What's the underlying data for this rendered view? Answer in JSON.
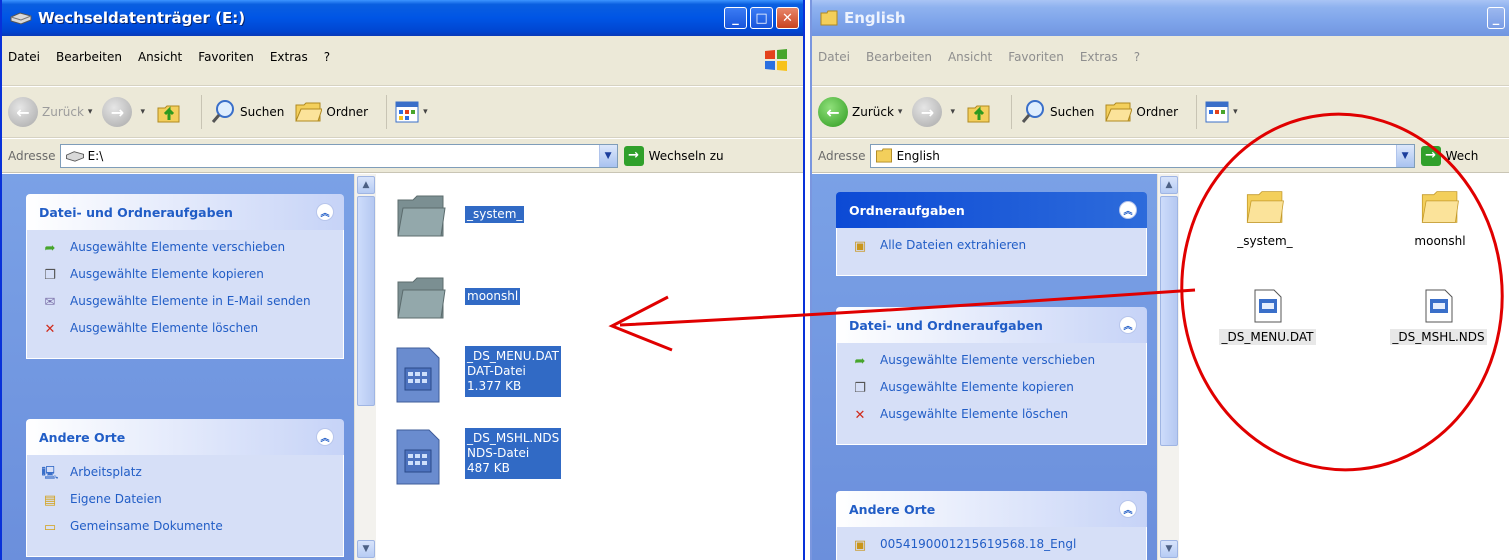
{
  "left_window": {
    "title": "Wechseldatenträger (E:)",
    "menu": [
      "Datei",
      "Bearbeiten",
      "Ansicht",
      "Favoriten",
      "Extras",
      "?"
    ],
    "toolbar": {
      "back": "Zurück",
      "search": "Suchen",
      "folders": "Ordner"
    },
    "address": {
      "label": "Adresse",
      "value": "E:\\",
      "go": "Wechseln zu"
    },
    "task_panels": [
      {
        "title": "Datei- und Ordneraufgaben",
        "items": [
          "Ausgewählte Elemente verschieben",
          "Ausgewählte Elemente kopieren",
          "Ausgewählte Elemente in E-Mail senden",
          "Ausgewählte Elemente löschen"
        ]
      },
      {
        "title": "Andere Orte",
        "items": [
          "Arbeitsplatz",
          "Eigene Dateien",
          "Gemeinsame Dokumente"
        ]
      }
    ],
    "files": [
      {
        "name": "_system_",
        "type": "folder"
      },
      {
        "name": "moonshl",
        "type": "folder"
      },
      {
        "name": "_DS_MENU.DAT",
        "kind": "DAT-Datei",
        "size": "1.377 KB",
        "type": "file"
      },
      {
        "name": "_DS_MSHL.NDS",
        "kind": "NDS-Datei",
        "size": "487 KB",
        "type": "file"
      }
    ]
  },
  "right_window": {
    "title": "English",
    "menu": [
      "Datei",
      "Bearbeiten",
      "Ansicht",
      "Favoriten",
      "Extras",
      "?"
    ],
    "toolbar": {
      "back": "Zurück",
      "search": "Suchen",
      "folders": "Ordner"
    },
    "address": {
      "label": "Adresse",
      "value": "English",
      "go": "Wech"
    },
    "task_panels": [
      {
        "title": "Ordneraufgaben",
        "items": [
          "Alle Dateien extrahieren"
        ]
      },
      {
        "title": "Datei- und Ordneraufgaben",
        "items": [
          "Ausgewählte Elemente verschieben",
          "Ausgewählte Elemente kopieren",
          "Ausgewählte Elemente löschen"
        ]
      },
      {
        "title": "Andere Orte",
        "items": [
          "0054190001215619568.18_Engl"
        ]
      }
    ],
    "files": [
      {
        "name": "_system_",
        "type": "folder"
      },
      {
        "name": "moonshl",
        "type": "folder"
      },
      {
        "name": "_DS_MENU.DAT",
        "type": "file"
      },
      {
        "name": "_DS_MSHL.NDS",
        "type": "file"
      }
    ]
  },
  "colors": {
    "xp_blue": "#0055e5",
    "selection": "#316ac5",
    "annotation_red": "#e00000",
    "task_pane": "#6b8fdc"
  }
}
